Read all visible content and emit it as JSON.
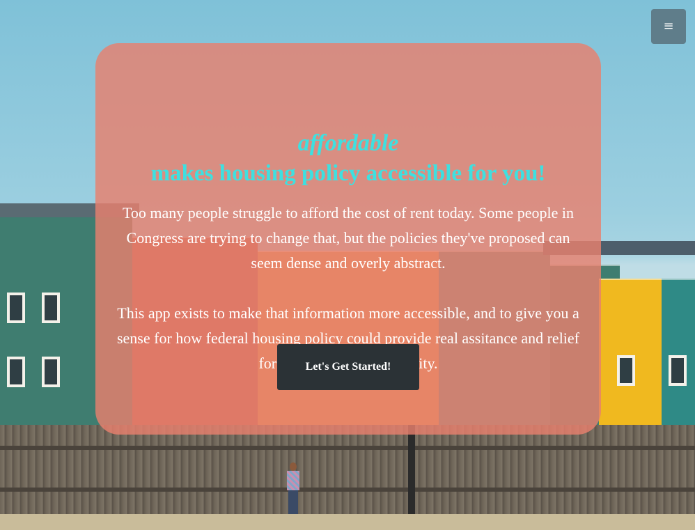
{
  "menu": {
    "icon": "hamburger-menu-icon",
    "glyph": "≡"
  },
  "hero": {
    "brand": "affordable",
    "headline": "makes housing policy accessible for you!",
    "paragraph_1": "Too many people struggle to afford the cost of rent today. Some people in Congress are trying to change that, but the policies they've proposed can seem dense and overly abstract.",
    "paragraph_2": "This app exists to make that information more accessible, and to give you a sense for how federal housing policy could provide real assitance and relief for you and your community.",
    "cta_label": "Let's Get Started!"
  },
  "colors": {
    "card": "#e8806e",
    "accent_text": "#3ee0e0",
    "cta_bg": "#2b3236",
    "menu_bg": "#5f7d8a"
  }
}
